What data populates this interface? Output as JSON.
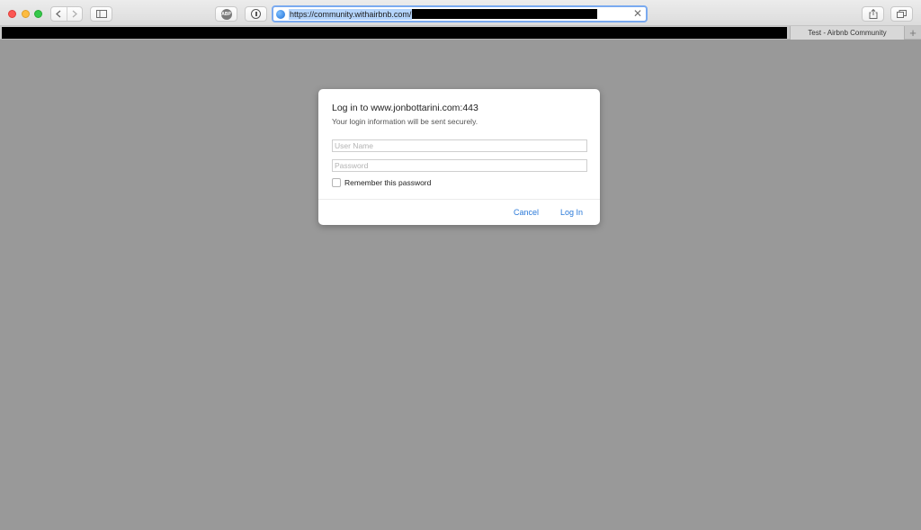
{
  "browser": {
    "address_bar": {
      "url": "https://community.withairbnb.com/",
      "url_redacted": true
    },
    "toolbar_icons": [
      "back-icon",
      "forward-icon",
      "sidebar-icon",
      "adblock-icon",
      "password-manager-icon",
      "share-icon",
      "tabs-overview-icon"
    ],
    "adblock_badge": "ABP",
    "tabs": [
      {
        "label": "",
        "redacted": true
      },
      {
        "label": "Test - Airbnb Community",
        "active": true
      }
    ],
    "new_tab_symbol": "+"
  },
  "dialog": {
    "title": "Log in to www.jonbottarini.com:443",
    "subtitle": "Your login information will be sent securely.",
    "username": {
      "value": "",
      "placeholder": "User Name"
    },
    "password": {
      "value": "",
      "placeholder": "Password"
    },
    "remember_label": "Remember this password",
    "remember_checked": false,
    "cancel_label": "Cancel",
    "login_label": "Log In"
  },
  "colors": {
    "page_background": "#999999",
    "accent_link": "#2b7ad9",
    "address_focus": "#7aaaf0",
    "traffic_red": "#fc5753",
    "traffic_yellow": "#fdbc40",
    "traffic_green": "#34c84a"
  }
}
